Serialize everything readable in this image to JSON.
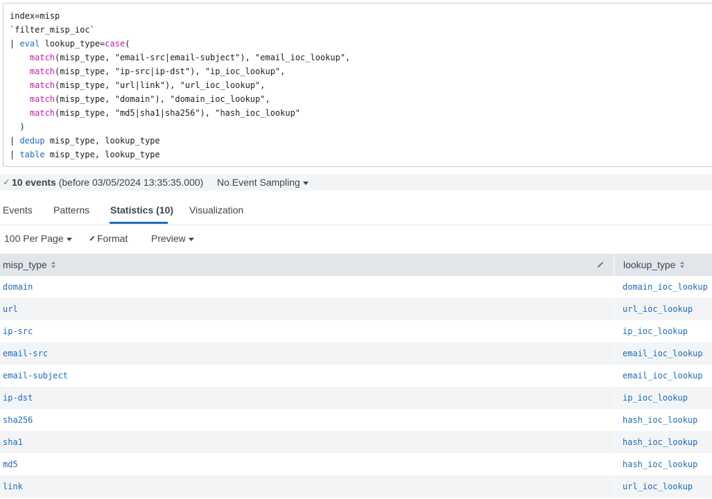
{
  "query": {
    "lines": [
      [
        {
          "t": "index=misp",
          "c": "str"
        }
      ],
      [
        {
          "t": "`filter_misp_ioc`",
          "c": "str"
        }
      ],
      [
        {
          "t": "| ",
          "c": "str"
        },
        {
          "t": "eval",
          "c": "kw"
        },
        {
          "t": " lookup_type=",
          "c": "str"
        },
        {
          "t": "case",
          "c": "fn"
        },
        {
          "t": "(",
          "c": "str"
        }
      ],
      [
        {
          "t": "    ",
          "c": "str"
        },
        {
          "t": "match",
          "c": "fn"
        },
        {
          "t": "(misp_type, \"email-src|email-subject\"), \"email_ioc_lookup\",",
          "c": "str"
        }
      ],
      [
        {
          "t": "    ",
          "c": "str"
        },
        {
          "t": "match",
          "c": "fn"
        },
        {
          "t": "(misp_type, \"ip-src|ip-dst\"), \"ip_ioc_lookup\",",
          "c": "str"
        }
      ],
      [
        {
          "t": "    ",
          "c": "str"
        },
        {
          "t": "match",
          "c": "fn"
        },
        {
          "t": "(misp_type, \"url|link\"), \"url_ioc_lookup\",",
          "c": "str"
        }
      ],
      [
        {
          "t": "    ",
          "c": "str"
        },
        {
          "t": "match",
          "c": "fn"
        },
        {
          "t": "(misp_type, \"domain\"), \"domain_ioc_lookup\",",
          "c": "str"
        }
      ],
      [
        {
          "t": "    ",
          "c": "str"
        },
        {
          "t": "match",
          "c": "fn"
        },
        {
          "t": "(misp_type, \"md5|sha1|sha256\"), \"hash_ioc_lookup\"",
          "c": "str"
        }
      ],
      [
        {
          "t": "  )",
          "c": "str"
        }
      ],
      [
        {
          "t": "| ",
          "c": "str"
        },
        {
          "t": "dedup",
          "c": "kw"
        },
        {
          "t": " misp_type, lookup_type",
          "c": "str"
        }
      ],
      [
        {
          "t": "| ",
          "c": "str"
        },
        {
          "t": "table",
          "c": "kw"
        },
        {
          "t": " misp_type, lookup_type",
          "c": "str"
        }
      ]
    ]
  },
  "status": {
    "check_icon": "check-icon",
    "events_count": "10 events",
    "events_detail": " (before 03/05/2024 13:35:35.000)",
    "sampling": "No Event Sampling"
  },
  "tabs": [
    {
      "label": "Events"
    },
    {
      "label": "Patterns"
    },
    {
      "label": "Statistics (10)",
      "active": true
    },
    {
      "label": "Visualization"
    }
  ],
  "toolbar": {
    "per_page": "100 Per Page",
    "format": "Format",
    "preview": "Preview"
  },
  "table": {
    "columns": [
      "misp_type",
      "lookup_type"
    ],
    "rows": [
      [
        "domain",
        "domain_ioc_lookup"
      ],
      [
        "url",
        "url_ioc_lookup"
      ],
      [
        "ip-src",
        "ip_ioc_lookup"
      ],
      [
        "email-src",
        "email_ioc_lookup"
      ],
      [
        "email-subject",
        "email_ioc_lookup"
      ],
      [
        "ip-dst",
        "ip_ioc_lookup"
      ],
      [
        "sha256",
        "hash_ioc_lookup"
      ],
      [
        "sha1",
        "hash_ioc_lookup"
      ],
      [
        "md5",
        "hash_ioc_lookup"
      ],
      [
        "link",
        "url_ioc_lookup"
      ]
    ]
  },
  "colors": {
    "link": "#1c6bbf",
    "keyword": "#1c6bbf",
    "function": "#c21aab",
    "success": "#53a051",
    "header_bg": "#e1e6eb"
  }
}
